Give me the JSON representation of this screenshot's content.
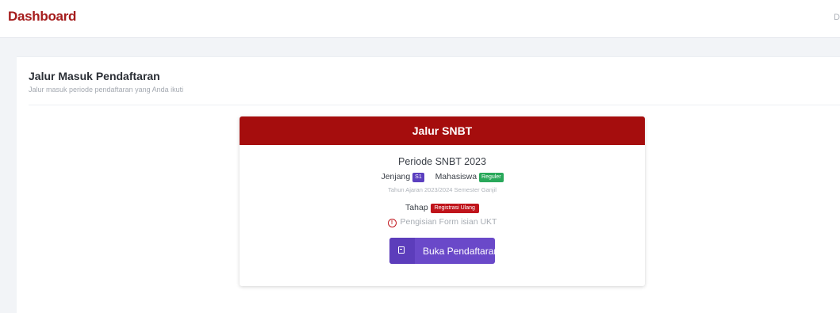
{
  "header": {
    "brand": "Dashboard",
    "right_text": "Da"
  },
  "panel": {
    "title": "Jalur Masuk Pendaftaran",
    "subtitle": "Jalur masuk periode pendaftaran yang Anda ikuti"
  },
  "card": {
    "header": "Jalur SNBT",
    "periode": "Periode SNBT 2023",
    "jenjang_label": "Jenjang",
    "jenjang_value": "S1",
    "mahasiswa_label": "Mahasiswa",
    "mahasiswa_value": "Reguler",
    "tahun": "Tahun Ajaran 2023/2024 Semester Ganjil",
    "tahap_label": "Tahap",
    "tahap_value": "Registrasi Ulang",
    "info_text": "Pengisian Form isian UKT",
    "button_label": "Buka Pendaftaran"
  },
  "colors": {
    "brand": "#a51c1c",
    "card_header": "#a50d0d",
    "button": "#6a49c9",
    "badge_jenjang": "#5b3fbf",
    "badge_mahasiswa": "#29a85a",
    "badge_tahap": "#c0141b"
  },
  "icons": {
    "info": "info-circle-icon",
    "button": "calendar-icon"
  }
}
